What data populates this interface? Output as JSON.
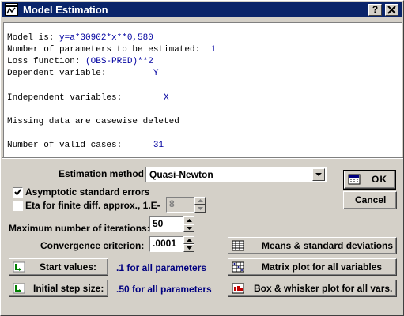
{
  "window": {
    "title": "Model Estimation"
  },
  "titlebar": {
    "help_label": "?",
    "close_label": "X"
  },
  "info": {
    "model_label": "Model is: ",
    "model_value": "y=a*30902*x**0,580",
    "num_params_label": "Number of parameters to be estimated:  ",
    "num_params_value": "1",
    "loss_label": "Loss function: ",
    "loss_value": "(OBS-PRED)**2",
    "dep_label": "Dependent variable:         ",
    "dep_value": "Y",
    "indep_label": "Independent variables:        ",
    "indep_value": "X",
    "missing_text": "Missing data are casewise deleted",
    "valid_label": "Number of valid cases:      ",
    "valid_value": "31"
  },
  "form": {
    "estimation_method_label": "Estimation method:",
    "estimation_method_value": "Quasi-Newton",
    "asymptotic_label": "Asymptotic standard errors",
    "asymptotic_checked": true,
    "eta_label": "Eta for finite diff. approx., 1.E-",
    "eta_checked": false,
    "eta_value": "8",
    "max_iter_label": "Maximum number of iterations:",
    "max_iter_value": "50",
    "convergence_label": "Convergence criterion:",
    "convergence_value": ".0001",
    "start_values_button": "Start values:",
    "start_values_text": ".1 for all parameters",
    "initial_step_button": "Initial step size:",
    "initial_step_text": ".50 for all parameters"
  },
  "buttons": {
    "ok": "OK",
    "cancel": "Cancel",
    "means": "Means & standard deviations",
    "matrix": "Matrix plot for all variables",
    "box": "Box & whisker plot for all vars."
  },
  "colors": {
    "titlebar": "#0a246a",
    "value_text": "#0000a0",
    "link_text": "#000080",
    "face": "#d4d0c8"
  }
}
